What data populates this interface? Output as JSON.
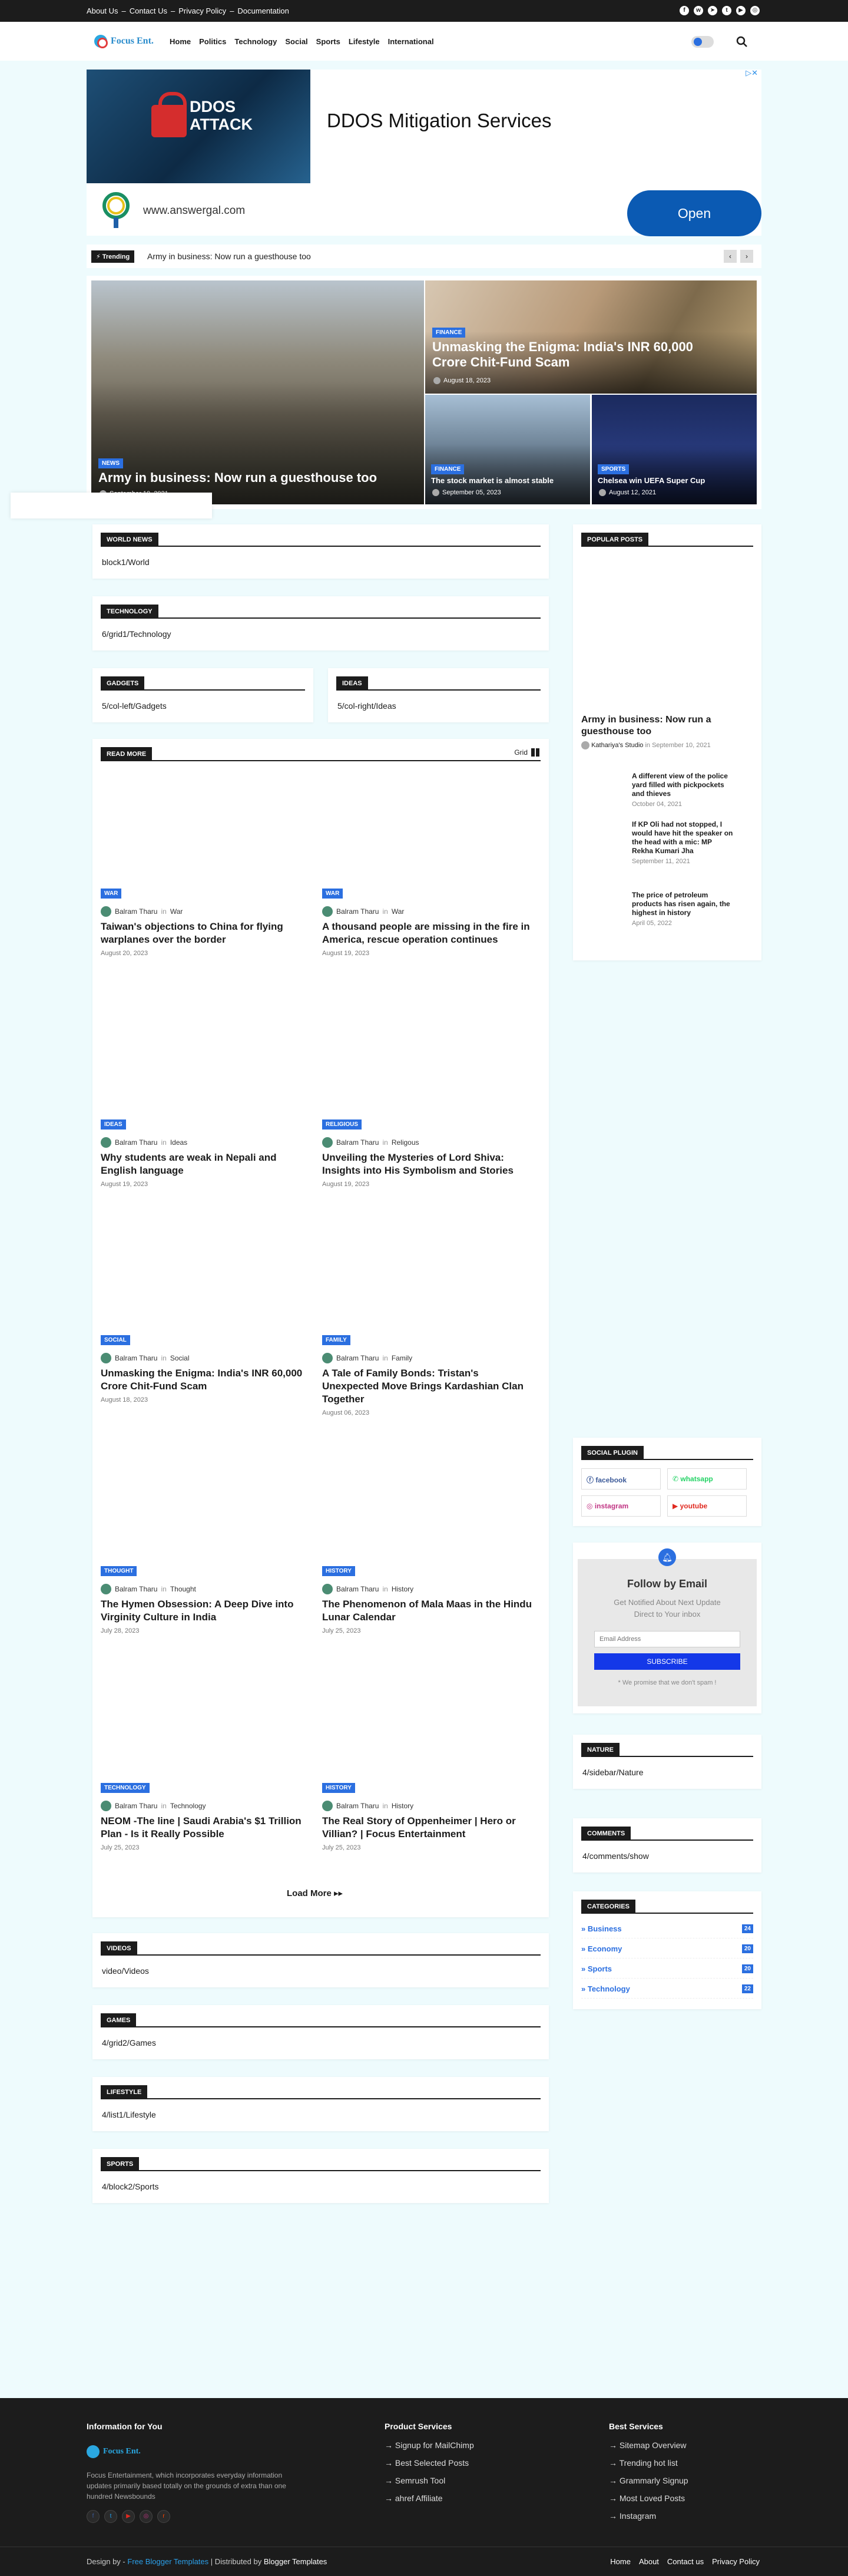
{
  "topbar": {
    "links": [
      "About Us",
      "Contact Us",
      "Privacy Policy",
      "Documentation"
    ],
    "separator": "–",
    "social_icons": [
      "facebook-icon",
      "whatsapp-icon",
      "telegram-icon",
      "twitter-icon",
      "youtube-icon",
      "instagram-icon"
    ]
  },
  "header": {
    "logo_text": "Focus Ent.",
    "nav": [
      "Home",
      "Politics",
      "Technology",
      "Social",
      "Sports",
      "Lifestyle",
      "International"
    ]
  },
  "ad": {
    "image_text": "DDOS ATTACK",
    "title": "DDOS Mitigation Services",
    "url": "www.answergal.com",
    "cta": "Open"
  },
  "trending": {
    "label": "Trending",
    "text": "Army in business: Now run a guesthouse too"
  },
  "hero": {
    "main": {
      "category": "NEWS",
      "title": "Army in business: Now run a guesthouse too",
      "date": "September 10, 2021"
    },
    "top_right": {
      "category": "FINANCE",
      "title": "Unmasking the Enigma: India's INR 60,000 Crore Chit-Fund Scam",
      "date": "August 18, 2023"
    },
    "bottom_left": {
      "category": "FINANCE",
      "title": "The stock market is almost stable",
      "date": "September 05, 2023"
    },
    "bottom_right": {
      "category": "SPORTS",
      "title": "Chelsea win UEFA Super Cup",
      "date": "August 12, 2021"
    }
  },
  "sections": {
    "world_news": {
      "label": "WORLD NEWS",
      "body": "block1/World"
    },
    "technology": {
      "label": "TECHNOLOGY",
      "body": "6/grid1/Technology"
    },
    "gadgets": {
      "label": "GADGETS",
      "body": "5/col-left/Gadgets"
    },
    "ideas": {
      "label": "IDEAS",
      "body": "5/col-right/Ideas"
    },
    "videos": {
      "label": "VIDEOS",
      "body": "video/Videos"
    },
    "games": {
      "label": "GAMES",
      "body": "4/grid2/Games"
    },
    "lifestyle": {
      "label": "LIFESTYLE",
      "body": "4/list1/Lifestyle"
    },
    "sports": {
      "label": "SPORTS",
      "body": "4/block2/Sports"
    }
  },
  "read_more": {
    "label": "READ MORE",
    "view": "Grid",
    "load_more": "Load More ▸▸",
    "in": "in",
    "posts": [
      {
        "category": "WAR",
        "author": "Balram Tharu",
        "topic": "War",
        "title": "Taiwan's objections to China for flying warplanes over the border",
        "date": "August 20, 2023"
      },
      {
        "category": "WAR",
        "author": "Balram Tharu",
        "topic": "War",
        "title": "A thousand people are missing in the fire in America, rescue operation continues",
        "date": "August 19, 2023"
      },
      {
        "category": "IDEAS",
        "author": "Balram Tharu",
        "topic": "Ideas",
        "title": "Why students are weak in Nepali and English language",
        "date": "August 19, 2023"
      },
      {
        "category": "RELIGIOUS",
        "author": "Balram Tharu",
        "topic": "Religous",
        "title": "Unveiling the Mysteries of Lord Shiva: Insights into His Symbolism and Stories",
        "date": "August 19, 2023"
      },
      {
        "category": "SOCIAL",
        "author": "Balram Tharu",
        "topic": "Social",
        "title": "Unmasking the Enigma: India's INR 60,000 Crore Chit-Fund Scam",
        "date": "August 18, 2023"
      },
      {
        "category": "FAMILY",
        "author": "Balram Tharu",
        "topic": "Family",
        "title": "A Tale of Family Bonds: Tristan's Unexpected Move Brings Kardashian Clan Together",
        "date": "August 06, 2023"
      },
      {
        "category": "THOUGHT",
        "author": "Balram Tharu",
        "topic": "Thought",
        "title": "The Hymen Obsession: A Deep Dive into Virginity Culture in India",
        "date": "July 28, 2023"
      },
      {
        "category": "HISTORY",
        "author": "Balram Tharu",
        "topic": "History",
        "title": "The Phenomenon of Mala Maas in the Hindu Lunar Calendar",
        "date": "July 25, 2023"
      },
      {
        "category": "TECHNOLOGY",
        "author": "Balram Tharu",
        "topic": "Technology",
        "title": "NEOM -The line | Saudi Arabia's $1 Trillion Plan - Is it Really Possible",
        "date": "July 25, 2023"
      },
      {
        "category": "HISTORY",
        "author": "Balram Tharu",
        "topic": "History",
        "title": "The Real Story of Oppenheimer | Hero or Villian? | Focus Entertainment",
        "date": "July 25, 2023"
      }
    ]
  },
  "sidebar": {
    "popular": {
      "label": "POPULAR POSTS",
      "featured": {
        "title": "Army in business: Now run a guesthouse too",
        "author": "Kathariya's Studio",
        "in": "in",
        "date": "September 10, 2021"
      },
      "items": [
        {
          "title": "A different view of the police yard filled with pickpockets and thieves",
          "date": "October 04, 2021"
        },
        {
          "title": "If KP Oli had not stopped, I would have hit the speaker on the head with a mic: MP Rekha Kumari Jha",
          "date": "September 11, 2021"
        },
        {
          "title": "The price of petroleum products has risen again, the highest in history",
          "date": "April 05, 2022"
        }
      ]
    },
    "social_plugin": {
      "label": "SOCIAL PLUGIN",
      "buttons": [
        {
          "name": "facebook",
          "color": "#3b5998"
        },
        {
          "name": "whatsapp",
          "color": "#25d366"
        },
        {
          "name": "instagram",
          "color": "#c13584"
        },
        {
          "name": "youtube",
          "color": "#e02a20"
        }
      ]
    },
    "follow": {
      "title": "Follow by Email",
      "subtitle": "Get Notified About Next Update Direct to Your inbox",
      "placeholder": "Email Address",
      "button": "SUBSCRIBE",
      "note": "* We promise that we don't spam !"
    },
    "nature": {
      "label": "NATURE",
      "body": "4/sidebar/Nature"
    },
    "comments": {
      "label": "COMMENTS",
      "body": "4/comments/show"
    },
    "categories": {
      "label": "CATEGORIES",
      "items": [
        {
          "name": "Business",
          "count": "24"
        },
        {
          "name": "Economy",
          "count": "20"
        },
        {
          "name": "Sports",
          "count": "20"
        },
        {
          "name": "Technology",
          "count": "22"
        }
      ]
    }
  },
  "footer": {
    "info_heading": "Information for You",
    "logo_text": "Focus Ent.",
    "description": "Focus Entertainment, which incorporates everyday information updates primarily based totally on the grounds of extra than one hundred Newsbounds",
    "product_heading": "Product Services",
    "product_links": [
      "Signup for MailChimp",
      "Best Selected Posts",
      "Semrush Tool",
      "ahref Affiliate"
    ],
    "best_heading": "Best Services",
    "best_links": [
      "Sitemap Overview",
      "Trending hot list",
      "Grammarly Signup",
      "Most Loved Posts",
      "Instagram"
    ],
    "credit_prefix": "Design by - ",
    "credit_link1": "Free Blogger Templates",
    "credit_mid": " | Distributed by ",
    "credit_link2": "Blogger Templates",
    "bottom_links": [
      "Home",
      "About",
      "Contact us",
      "Privacy Policy"
    ]
  },
  "colors": {
    "accent": "#2b6fe0",
    "dark": "#1c1c1c",
    "page_bg": "#eefbfd"
  }
}
